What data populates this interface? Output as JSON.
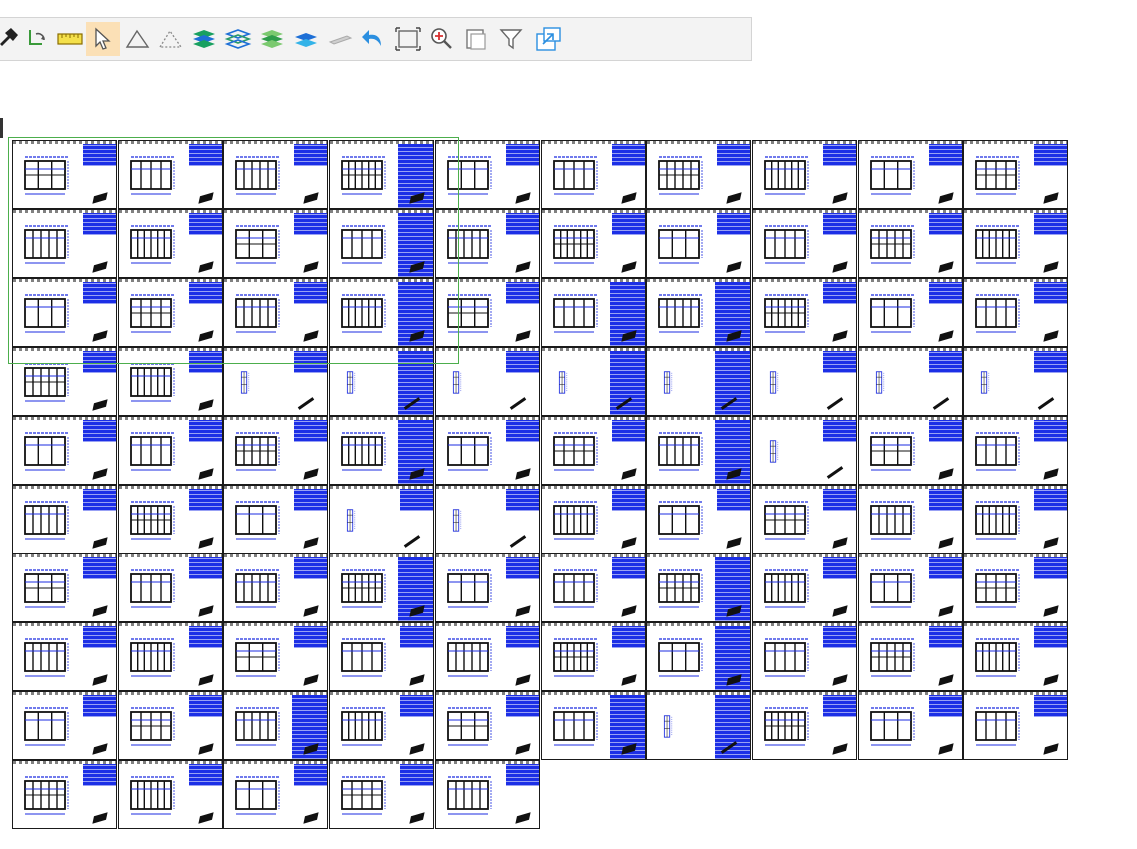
{
  "toolbar": {
    "items": [
      {
        "name": "pin-tool-button",
        "icon": "pin-icon"
      },
      {
        "name": "rotate-view-button",
        "icon": "rotate-arrow-icon"
      },
      {
        "name": "measure-tool-button",
        "icon": "ruler-icon"
      },
      {
        "name": "select-tool-button",
        "icon": "cursor-arrow-icon",
        "active": true
      },
      {
        "name": "area-tool-button",
        "icon": "triangle-icon"
      },
      {
        "name": "area-dashed-tool-button",
        "icon": "triangle-dashed-icon"
      },
      {
        "name": "layers-all-button",
        "icon": "layers-stack-icon"
      },
      {
        "name": "layers-outline-button",
        "icon": "layers-outline-icon"
      },
      {
        "name": "layers-green-button",
        "icon": "layers-green-icon"
      },
      {
        "name": "single-layer-button",
        "icon": "layer-single-icon"
      },
      {
        "name": "plane-tool-button",
        "icon": "plane-flat-icon"
      },
      {
        "name": "undo-button",
        "icon": "undo-arrow-icon"
      },
      {
        "name": "fit-view-button",
        "icon": "fit-frame-icon"
      },
      {
        "name": "zoom-in-button",
        "icon": "zoom-in-icon"
      },
      {
        "name": "copy-button",
        "icon": "copy-window-icon"
      },
      {
        "name": "filter-button",
        "icon": "filter-funnel-icon"
      },
      {
        "name": "export-button",
        "icon": "export-window-icon"
      }
    ]
  },
  "colors": {
    "toolbar_bg": "#f3f3f3",
    "active_tool": "#fbe0b6",
    "sheet_table_blue": "#1c2fe6",
    "drawing_blue": "#1b2be0",
    "selection_green": "#4cae4c",
    "frame_black": "#1a1a1a"
  },
  "grid": {
    "row_counts": [
      10,
      10,
      10,
      10,
      10,
      10,
      10,
      10,
      10,
      5
    ],
    "tall_tables": [
      [
        3
      ],
      [
        3
      ],
      [
        3,
        5,
        6
      ],
      [
        3,
        5,
        6
      ],
      [
        3,
        6
      ],
      [],
      [
        3,
        6
      ],
      [
        6
      ],
      [
        2,
        5,
        6
      ],
      []
    ],
    "column_sheets": [
      [],
      [],
      [],
      [
        2,
        3,
        4,
        5,
        6,
        7,
        8,
        9
      ],
      [
        7
      ],
      [
        3,
        4
      ],
      [],
      [],
      [
        6
      ],
      []
    ]
  },
  "selection": {
    "rows": 3,
    "columns": 4.3
  }
}
